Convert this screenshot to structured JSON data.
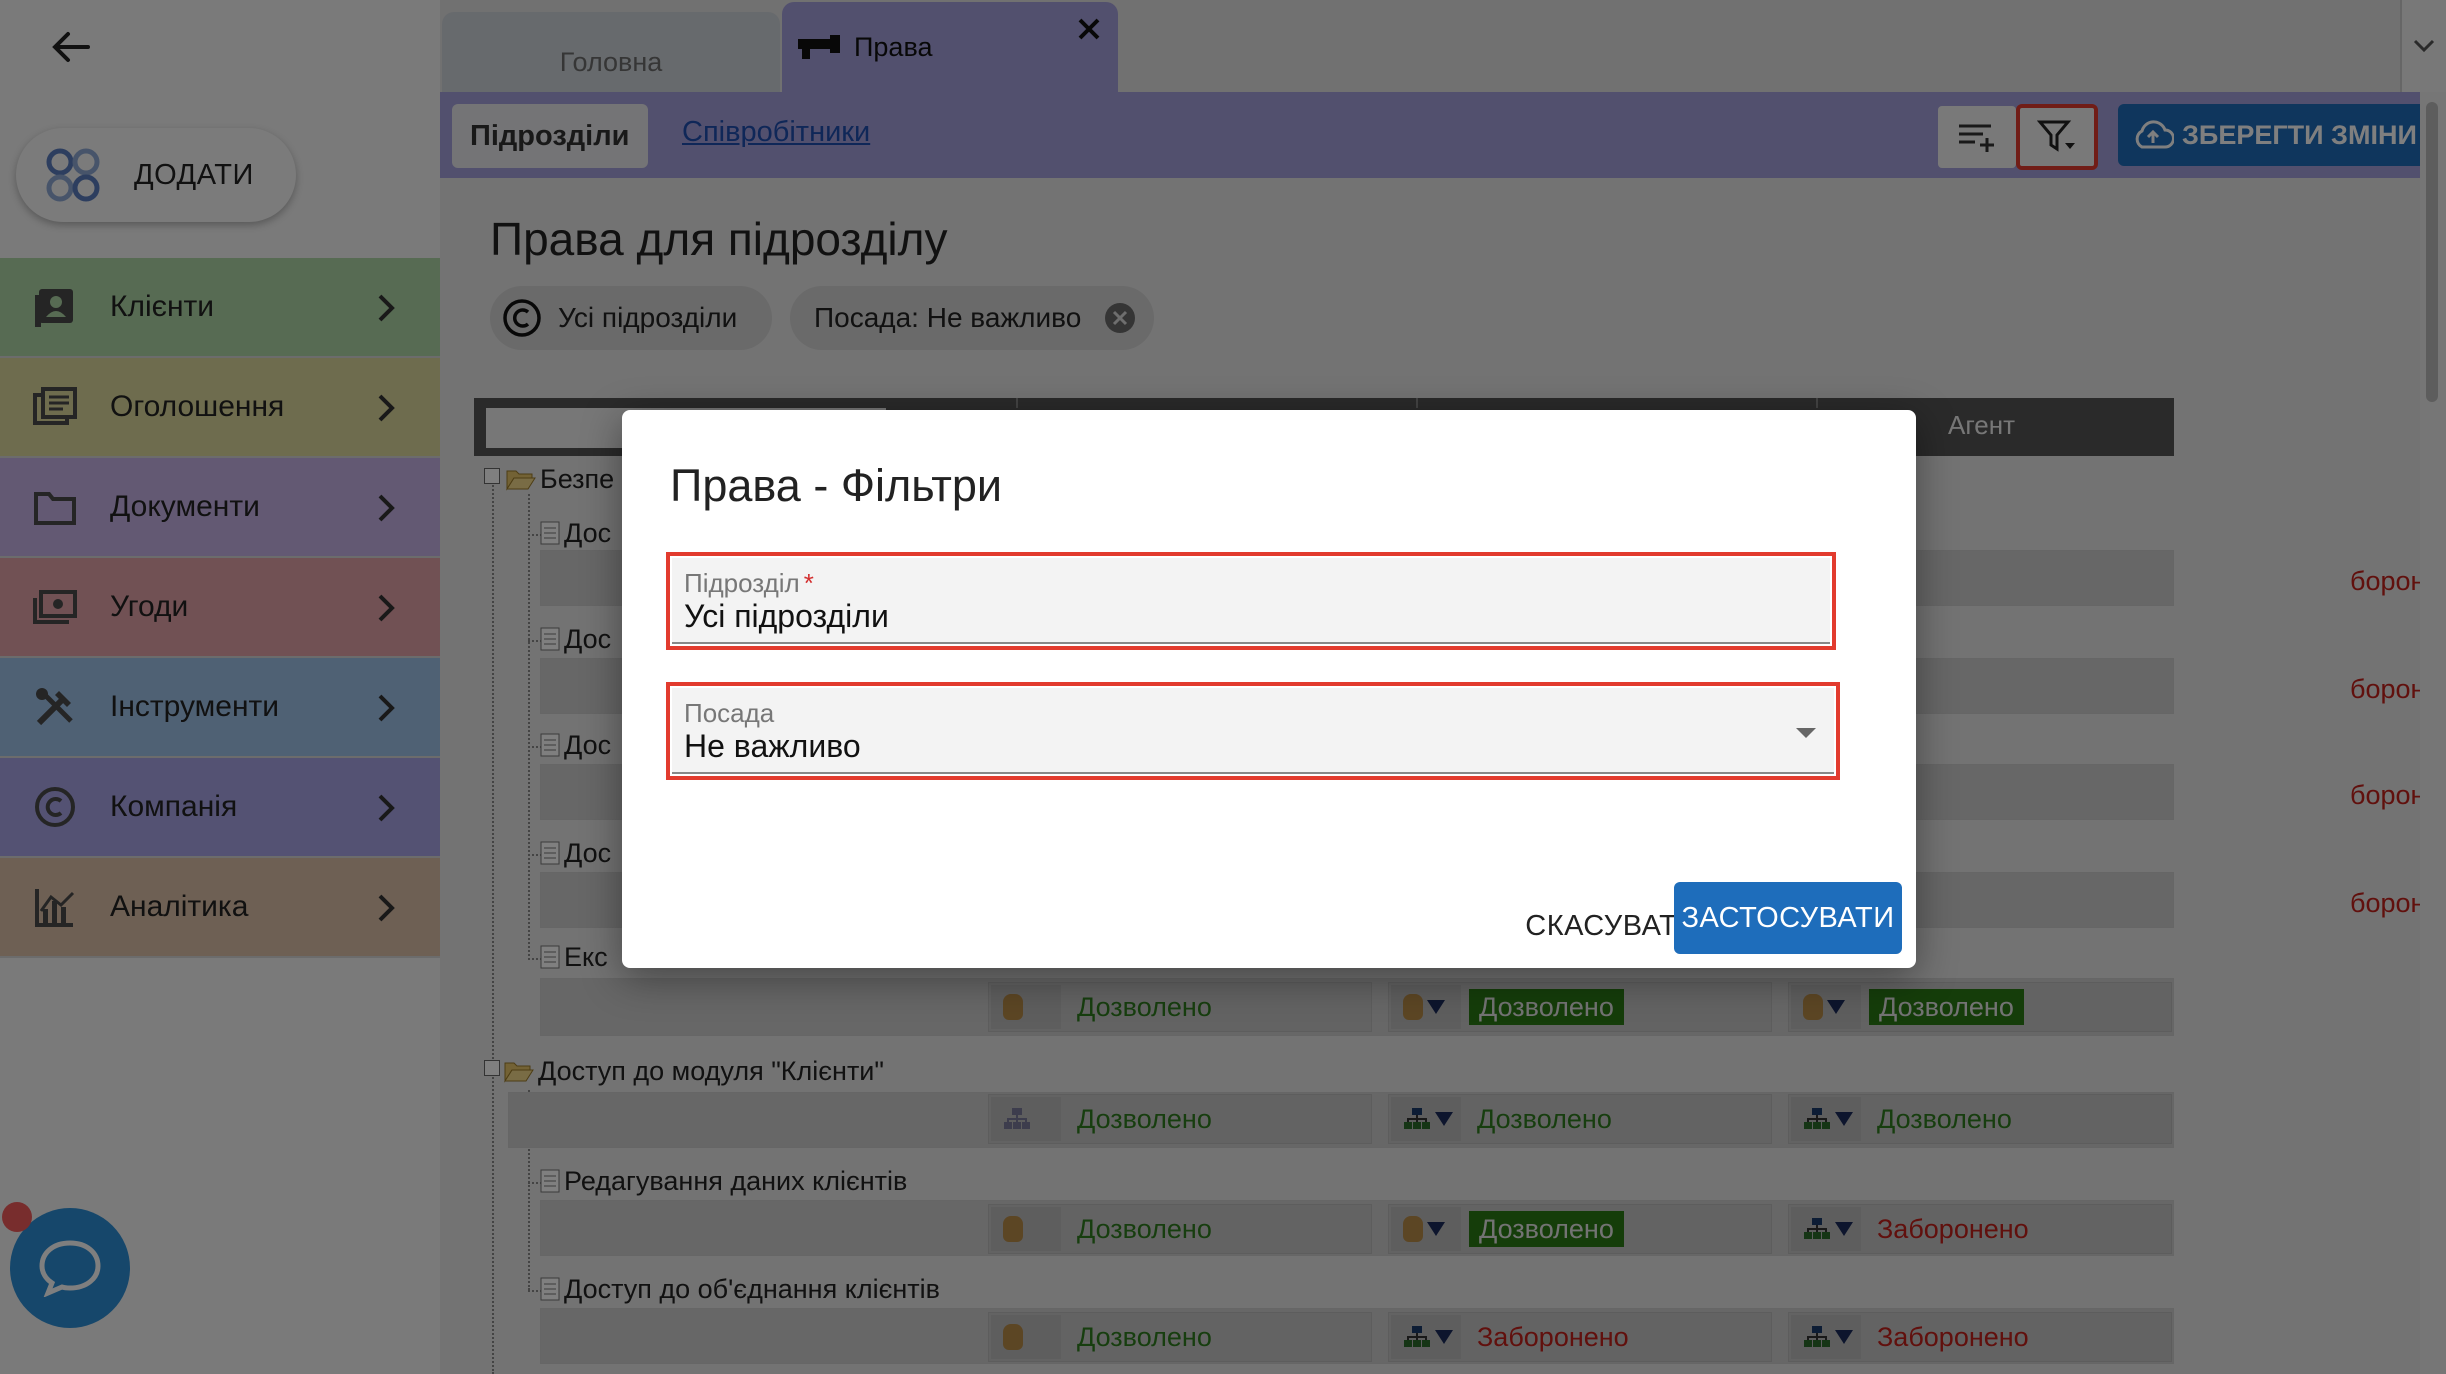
{
  "sidebar": {
    "add_label": "ДОДАТИ",
    "items": [
      {
        "label": "Клієнти",
        "color": "#aed6a6"
      },
      {
        "label": "Оголошення",
        "color": "#dcd99c"
      },
      {
        "label": "Документи",
        "color": "#c6b3e6"
      },
      {
        "label": "Угоди",
        "color": "#e2a3a8"
      },
      {
        "label": "Інструменти",
        "color": "#9fc2e8"
      },
      {
        "label": "Компанія",
        "color": "#a8a4e6"
      },
      {
        "label": "Аналітика",
        "color": "#dcc0a8"
      }
    ]
  },
  "tabs": {
    "home": "Головна",
    "rights": "Права"
  },
  "toolbar": {
    "sub_tab_units": "Підрозділи",
    "sub_tab_employees": "Співробітники",
    "save_label": "ЗБЕРЕГТИ ЗМІНИ"
  },
  "page": {
    "title": "Права для підрозділу",
    "chip_unit": "Усі підрозділи",
    "chip_position": "Посада: Не важливо"
  },
  "grid": {
    "col_agent": "Агент",
    "rows": [
      {
        "label": "Безпе",
        "type": "folder"
      },
      {
        "label": "Дос",
        "type": "doc",
        "agent": "боронено"
      },
      {
        "label": "Дос",
        "type": "doc",
        "agent": "боронено"
      },
      {
        "label": "Дос",
        "type": "doc",
        "agent": "боронено"
      },
      {
        "label": "Дос",
        "type": "doc",
        "agent": "боронено"
      },
      {
        "label": "Екс",
        "type": "doc",
        "c1": "Дозволено",
        "c2": "Дозволено",
        "c3": "Дозволено"
      },
      {
        "label": "Доступ до модуля \"Клієнти\"",
        "type": "folder",
        "c1": "Дозволено",
        "c2": "Дозволено",
        "c3": "Дозволено"
      },
      {
        "label": "Редагування даних клієнтів",
        "type": "doc",
        "c1": "Дозволено",
        "c2": "Дозволено",
        "c3": "Заборонено"
      },
      {
        "label": "Доступ до об'єднання клієнтів",
        "type": "doc",
        "c1": "Дозволено",
        "c2": "Заборонено",
        "c3": "Заборонено"
      }
    ]
  },
  "dialog": {
    "title": "Права - Фільтри",
    "unit_label": "Підрозділ",
    "unit_required": "*",
    "unit_value": "Усі підрозділи",
    "position_label": "Посада",
    "position_value": "Не важливо",
    "cancel_label": "СКАСУВАТИ",
    "apply_label": "ЗАСТОСУВАТИ"
  }
}
